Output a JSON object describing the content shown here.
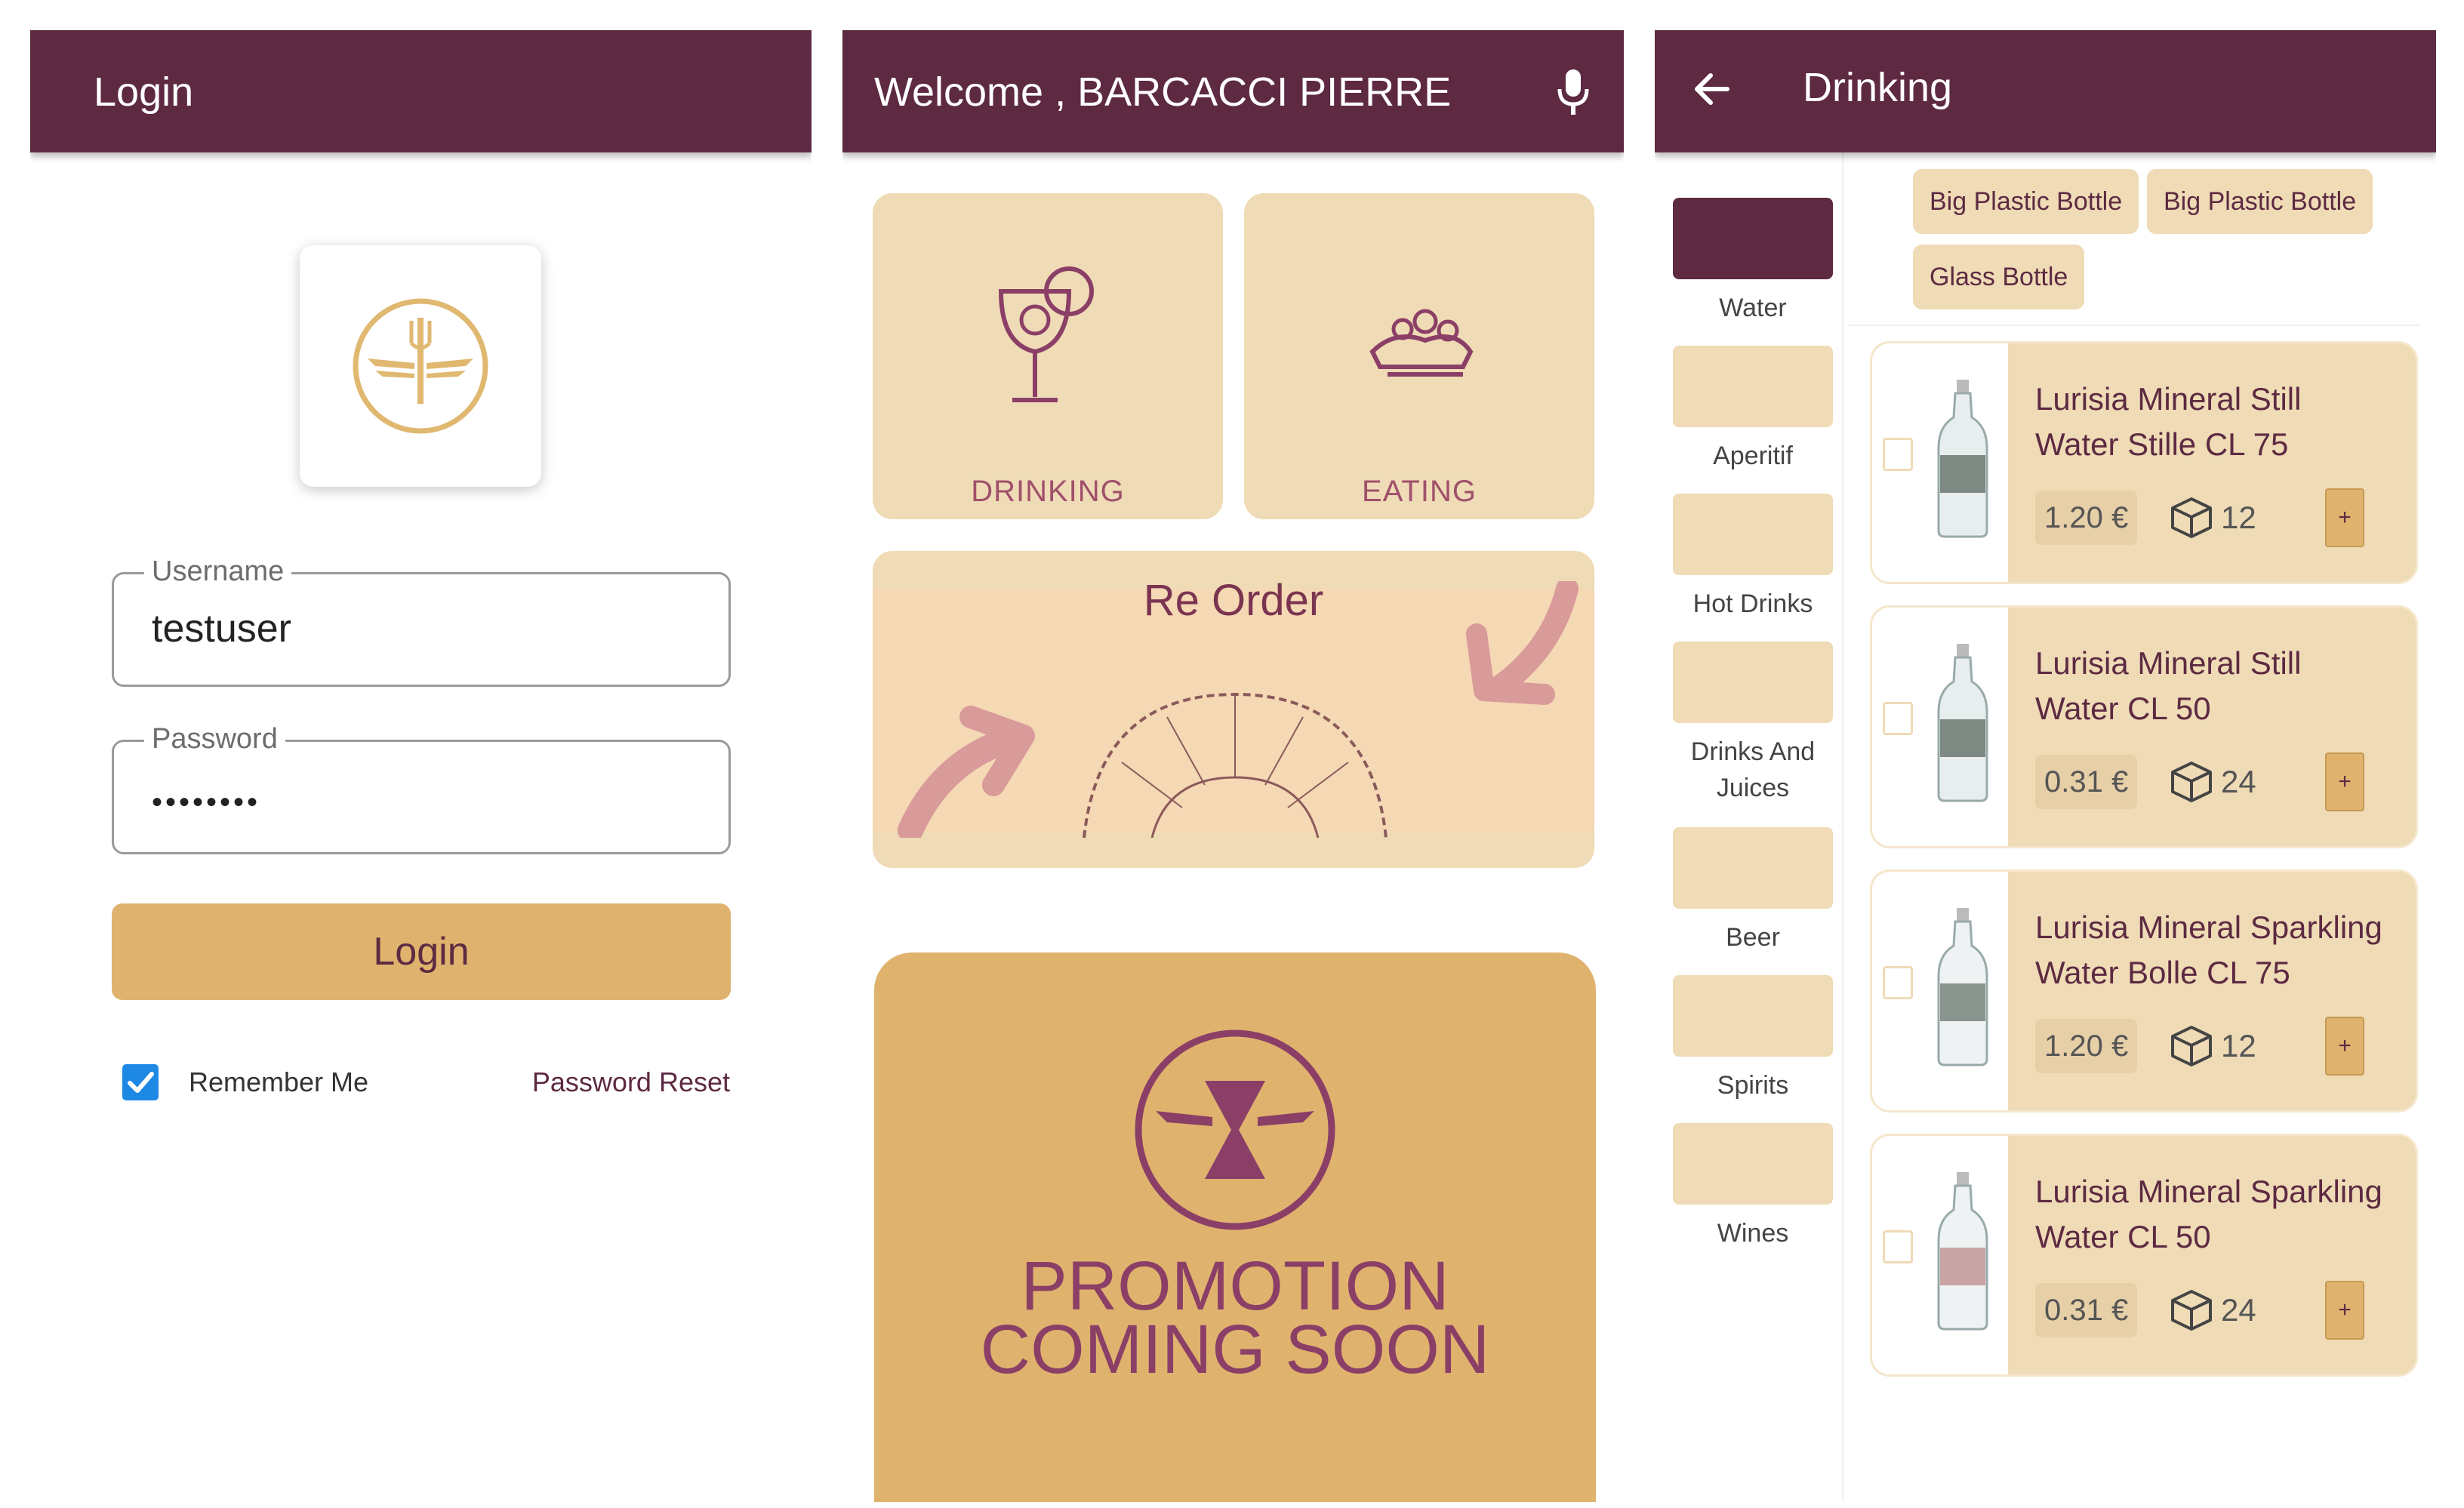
{
  "login": {
    "title": "Login",
    "username_label": "Username",
    "username_value": "testuser",
    "password_label": "Password",
    "password_value": "••••••••",
    "login_button": "Login",
    "remember_me": "Remember Me",
    "remember_checked": true,
    "password_reset": "Password Reset"
  },
  "home": {
    "title": "Welcome , BARCACCI PIERRE",
    "tiles": [
      "DRINKING",
      "EATING"
    ],
    "reorder_title": "Re Order",
    "promo_line1": "PROMOTION",
    "promo_line2": "COMING SOON"
  },
  "drinking": {
    "title": "Drinking",
    "categories": [
      "Water",
      "Aperitif",
      "Hot Drinks",
      "Drinks And Juices",
      "Beer",
      "Spirits",
      "Wines"
    ],
    "active_category": "Water",
    "chips": [
      "Big Plastic Bottle",
      "Big Plastic Bottle",
      "Glass Bottle"
    ],
    "products": [
      {
        "name_line1": "Lurisia Mineral Still",
        "name_line2": "Water Stille  CL 75",
        "price": "1.20 €",
        "qty": "12"
      },
      {
        "name_line1": "Lurisia Mineral Still",
        "name_line2": "Water CL 50",
        "price": "0.31 €",
        "qty": "24"
      },
      {
        "name_line1": "Lurisia Mineral Sparkling",
        "name_line2": "Water Bolle CL 75",
        "price": "1.20 €",
        "qty": "12"
      },
      {
        "name_line1": "Lurisia Mineral Sparkling",
        "name_line2": "Water CL 50",
        "price": "0.31 €",
        "qty": "24"
      }
    ],
    "plus_label": "+"
  },
  "colors": {
    "primary": "#5d2a42",
    "tile": "#efdbb6",
    "accent": "#dfb36e",
    "checkbox": "#1e88e5"
  }
}
